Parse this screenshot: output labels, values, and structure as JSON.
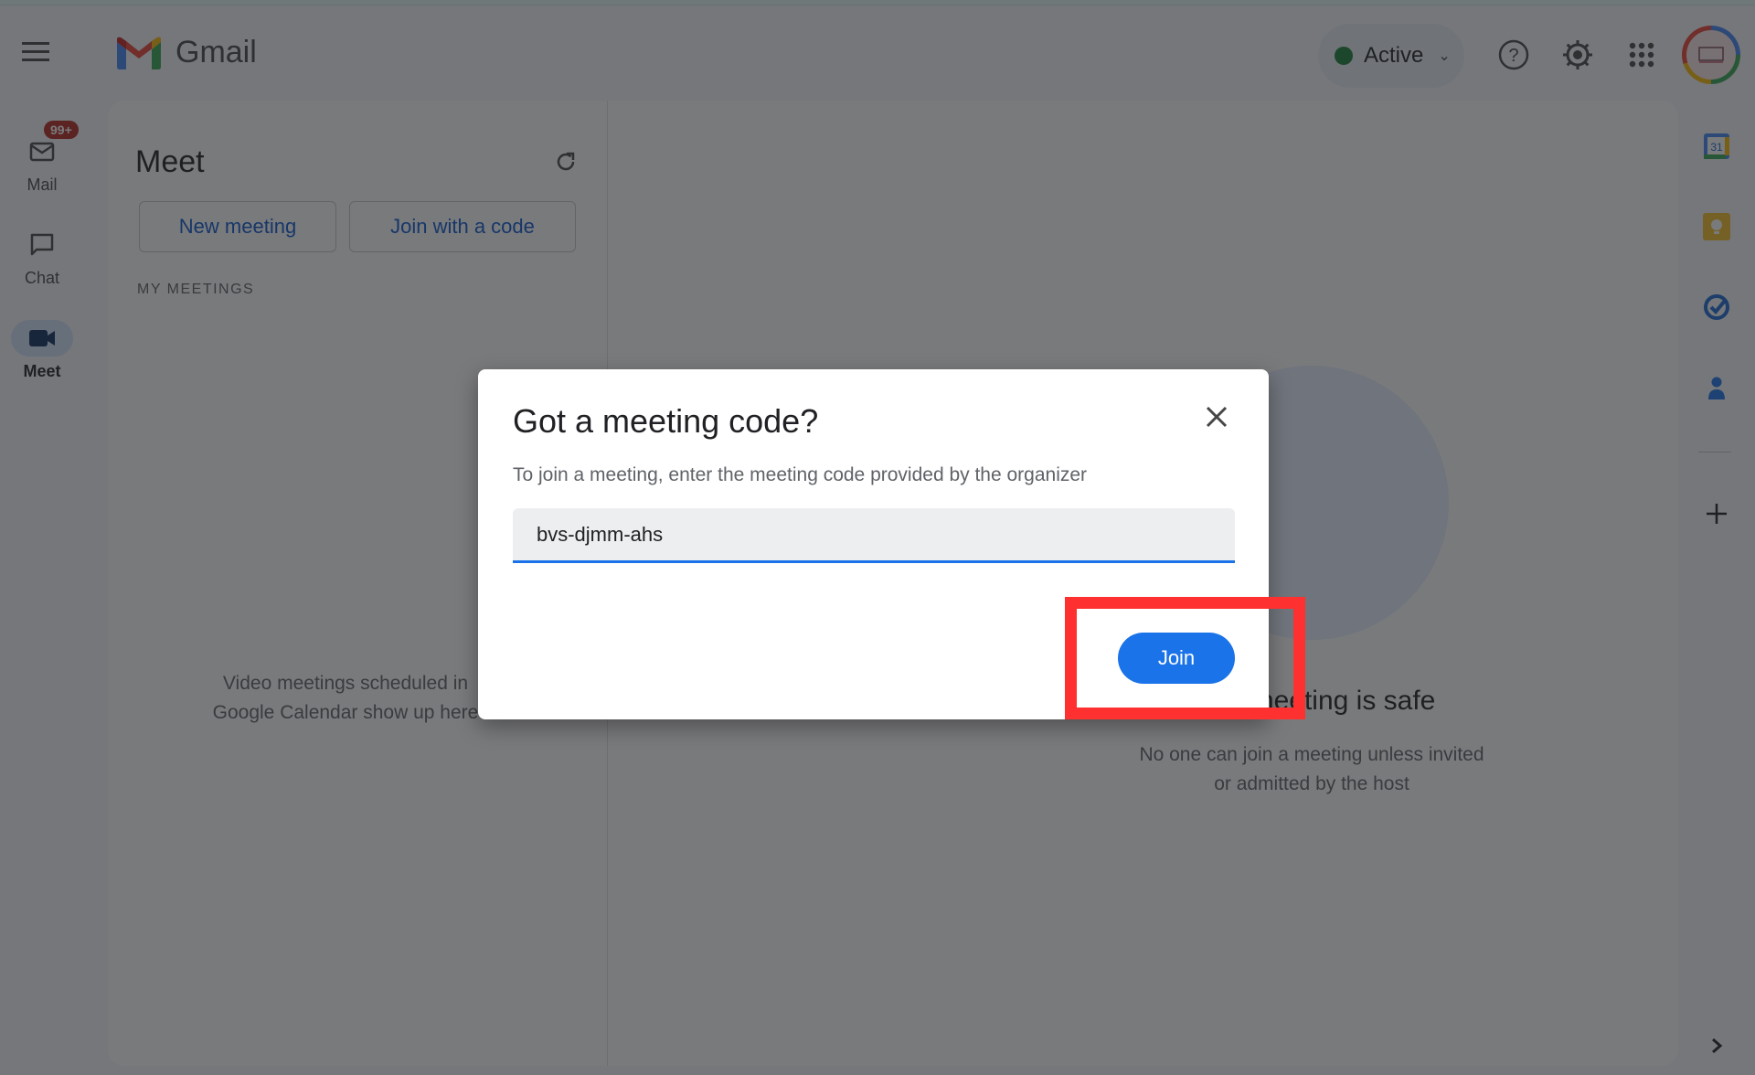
{
  "app": {
    "name": "Gmail",
    "status": {
      "label": "Active",
      "color": "#188038"
    }
  },
  "header": {
    "icons": [
      "menu-icon",
      "help-icon",
      "settings-icon",
      "apps-grid-icon",
      "account-avatar"
    ]
  },
  "rail": {
    "items": [
      {
        "label": "Mail",
        "icon": "mail-icon",
        "badge": "99+"
      },
      {
        "label": "Chat",
        "icon": "chat-icon"
      },
      {
        "label": "Meet",
        "icon": "video-camera-icon",
        "active": true
      }
    ]
  },
  "meet": {
    "title": "Meet",
    "new_meeting_label": "New meeting",
    "join_code_label": "Join with a code",
    "section_label": "MY MEETINGS",
    "empty_line1": "Video meetings scheduled in",
    "empty_line2": "Google Calendar show up here",
    "hero_title": "Your meeting is safe",
    "hero_sub_line1": "No one can join a meeting unless invited",
    "hero_sub_line2": "or admitted by the host"
  },
  "side_panel": {
    "icons": [
      "calendar-icon",
      "keep-icon",
      "tasks-icon",
      "contacts-icon",
      "add-icon",
      "expand-chevron-icon"
    ],
    "calendar_day": "31"
  },
  "dialog": {
    "title": "Got a meeting code?",
    "description": "To join a meeting, enter the meeting code provided by the organizer",
    "input_value": "bvs-djmm-ahs",
    "join_label": "Join"
  },
  "colors": {
    "accent": "#1a73e8",
    "highlight": "#ff3030",
    "badge": "#b3261e"
  }
}
